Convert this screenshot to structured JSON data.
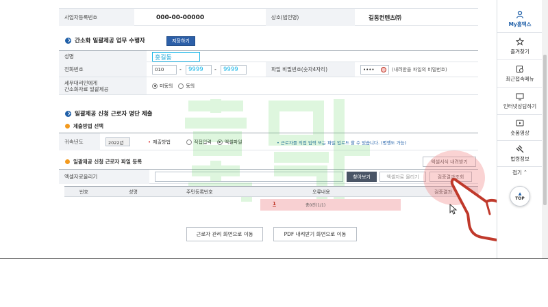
{
  "business_info": {
    "reg_no_label": "사업자등록번호",
    "reg_no_value": "000-00-00000",
    "company_label": "상호(법인명)",
    "company_value": "길동컨텐츠㈜"
  },
  "section1": {
    "title": "간소화 일괄제공 업무 수행자",
    "save_button": "저장하기",
    "name_label": "성명",
    "name_value": "홍길동",
    "phone_label": "전화번호",
    "phone_area": "010",
    "phone_mid": "9999",
    "phone_last": "9999",
    "dash1": "-",
    "dash2": "-",
    "pw_label": "파일 비밀번호(숫자4자리)",
    "pw_value": "••••",
    "pw_note": "(내려받을 파일의 비밀번호)",
    "consent_label_line1": "세무대리인에게",
    "consent_label_line2": "간소화자료 일괄제공",
    "consent_opt_no": "미동의",
    "consent_opt_yes": "동의"
  },
  "section2": {
    "title": "일괄제공 신청 근로자 명단 제출",
    "method_title": "제출방법 선택",
    "year_label": "귀속년도",
    "year_value": "2022년",
    "method_label": "제출방법",
    "method_direct": "직접입력",
    "method_excel": "엑셀파일",
    "method_note": "• 근로자를 직접 입력 또는 파일 업로드 할 수 있습니다. (병행도 가능)",
    "upload_title": "일괄제공 신청 근로자 파일 등록",
    "excel_download_button": "엑셀서식 내려받기",
    "upload_label": "엑셀자료올리기",
    "browse_button": "찾아보기",
    "upload_button": "엑셀자료 올리기",
    "verify_button": "검증결과조회"
  },
  "grid": {
    "headers": [
      "번호",
      "성명",
      "주민등록번호",
      "오류내용",
      "검증결과"
    ],
    "page_link": "1",
    "page_summary": "총0건(1/1)"
  },
  "bottom_buttons": {
    "manage": "근로자 관리 화면으로 이동",
    "pdf": "PDF 내려받기 화면으로 이동"
  },
  "quick_menu": {
    "items": [
      {
        "label": "My홈택스",
        "icon": "person-icon"
      },
      {
        "label": "즐겨찾기",
        "icon": "star-icon"
      },
      {
        "label": "최근접속메뉴",
        "icon": "recent-icon"
      },
      {
        "label": "인터넷상담하기",
        "icon": "monitor-icon"
      },
      {
        "label": "숏폼영상",
        "icon": "play-icon"
      },
      {
        "label": "법령정보",
        "icon": "gavel-icon"
      }
    ],
    "fold_label": "접기",
    "top_label": "TOP"
  },
  "colors": {
    "primary": "#2c5fa8",
    "accent_orange": "#f39a1e",
    "input_highlight": "#20b8e8",
    "error_row": "#f8d0d2",
    "verify_highlight": "#f2a3a3"
  }
}
